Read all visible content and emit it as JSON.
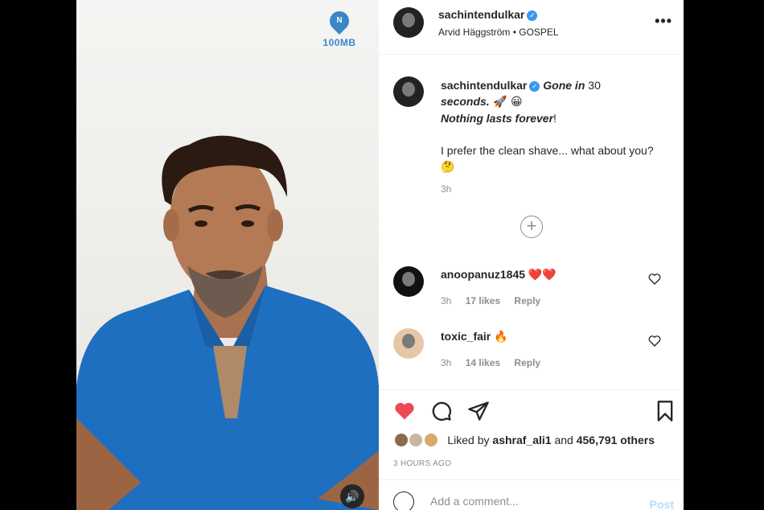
{
  "video": {
    "watermark": "100MB",
    "watermark_logo": "N",
    "mute_icon": "speaker-icon"
  },
  "header": {
    "username": "sachintendulkar",
    "subtitle": "Arvid Häggström • GOSPEL",
    "more": "•••"
  },
  "caption": {
    "username": "sachintendulkar",
    "line1_em": "Gone in",
    "line1_rest": " 30",
    "line2_em": "seconds.",
    "line2_emoji": " 🚀 😀",
    "line3_em": "Nothing lasts forever",
    "line3_rest": "!",
    "line4": "I prefer the clean shave... what about you? 🤔",
    "time": "3h"
  },
  "comments": [
    {
      "username": "anoopanuz1845",
      "text": "❤️❤️",
      "time": "3h",
      "likes": "17 likes",
      "reply": "Reply"
    },
    {
      "username": "toxic_fair",
      "text": "🔥",
      "time": "3h",
      "likes": "14 likes",
      "reply": "Reply"
    }
  ],
  "actions": {
    "liked_by_prefix": "Liked by ",
    "liked_by_user": "ashraf_ali1",
    "liked_by_and": " and ",
    "liked_by_count": "456,791 others",
    "timestamp": "3 HOURS AGO"
  },
  "add_comment": {
    "placeholder": "Add a comment...",
    "post": "Post"
  },
  "colors": {
    "like_red": "#ed4956",
    "verified_blue": "#3897f0",
    "post_disabled": "#b2dffc"
  }
}
